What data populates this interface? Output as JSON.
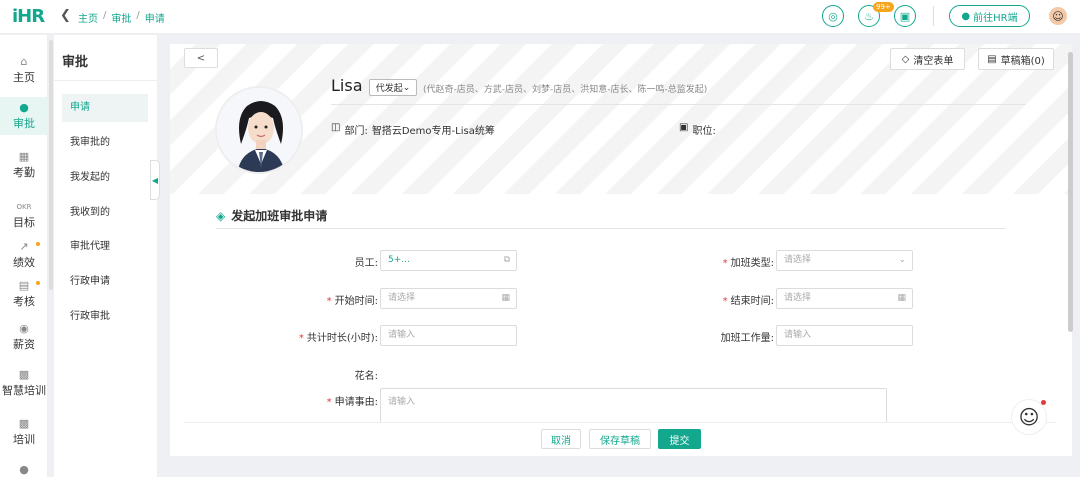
{
  "app": {
    "logo_text": "iHR"
  },
  "breadcrumb": {
    "items": [
      "主页",
      "审批",
      "申请"
    ]
  },
  "topbar": {
    "notification_badge": "99+",
    "hr_button_label": "前往HR端"
  },
  "nav": {
    "items": [
      {
        "label": "主页",
        "icon": "home-icon"
      },
      {
        "label": "审批",
        "icon": "user-icon",
        "active": true
      },
      {
        "label": "考勤",
        "icon": "calendar-icon"
      },
      {
        "label": "目标",
        "icon": "okr-icon",
        "icon_text": "OKR"
      },
      {
        "label": "绩效",
        "icon": "chart-icon",
        "dot": true
      },
      {
        "label": "考核",
        "icon": "document-icon",
        "dot": true
      },
      {
        "label": "薪资",
        "icon": "money-icon"
      },
      {
        "label": "智慧培训",
        "icon": "book-icon"
      },
      {
        "label": "培训",
        "icon": "book-icon"
      }
    ]
  },
  "subnav": {
    "title": "审批",
    "items": [
      "申请",
      "我审批的",
      "我发起的",
      "我收到的",
      "审批代理",
      "行政申请",
      "行政审批"
    ]
  },
  "toolbar": {
    "back_label": "<",
    "clear_label": "清空表单",
    "drafts_label": "草稿箱(0)"
  },
  "profile": {
    "name": "Lisa",
    "proxy_label": "代发起",
    "proxy_list": "(代赵奇-店员、方武-店员、刘梦-店员、洪知意-店长、陈一鸣-总监发起)",
    "dept_label": "部门:",
    "dept_value": "智搭云Demo专用-Lisa统筹",
    "position_label": "职位:",
    "position_value": ""
  },
  "form": {
    "title": "发起加班审批申请",
    "employee_label": "员工:",
    "employee_value": "5+...",
    "type_label": "加班类型:",
    "type_placeholder": "请选择",
    "start_label": "开始时间:",
    "start_placeholder": "请选择",
    "end_label": "结束时间:",
    "end_placeholder": "请选择",
    "hours_label": "共计时长(小时):",
    "hours_placeholder": "请输入",
    "workload_label": "加班工作量:",
    "workload_placeholder": "请输入",
    "flower_label": "花名:",
    "reason_label": "申请事由:",
    "reason_placeholder": "请输入"
  },
  "footer": {
    "cancel_label": "取消",
    "save_draft_label": "保存草稿",
    "submit_label": "提交"
  },
  "colors": {
    "accent": "#13a88e",
    "required": "#e4393c",
    "badge": "#f7a51c"
  }
}
